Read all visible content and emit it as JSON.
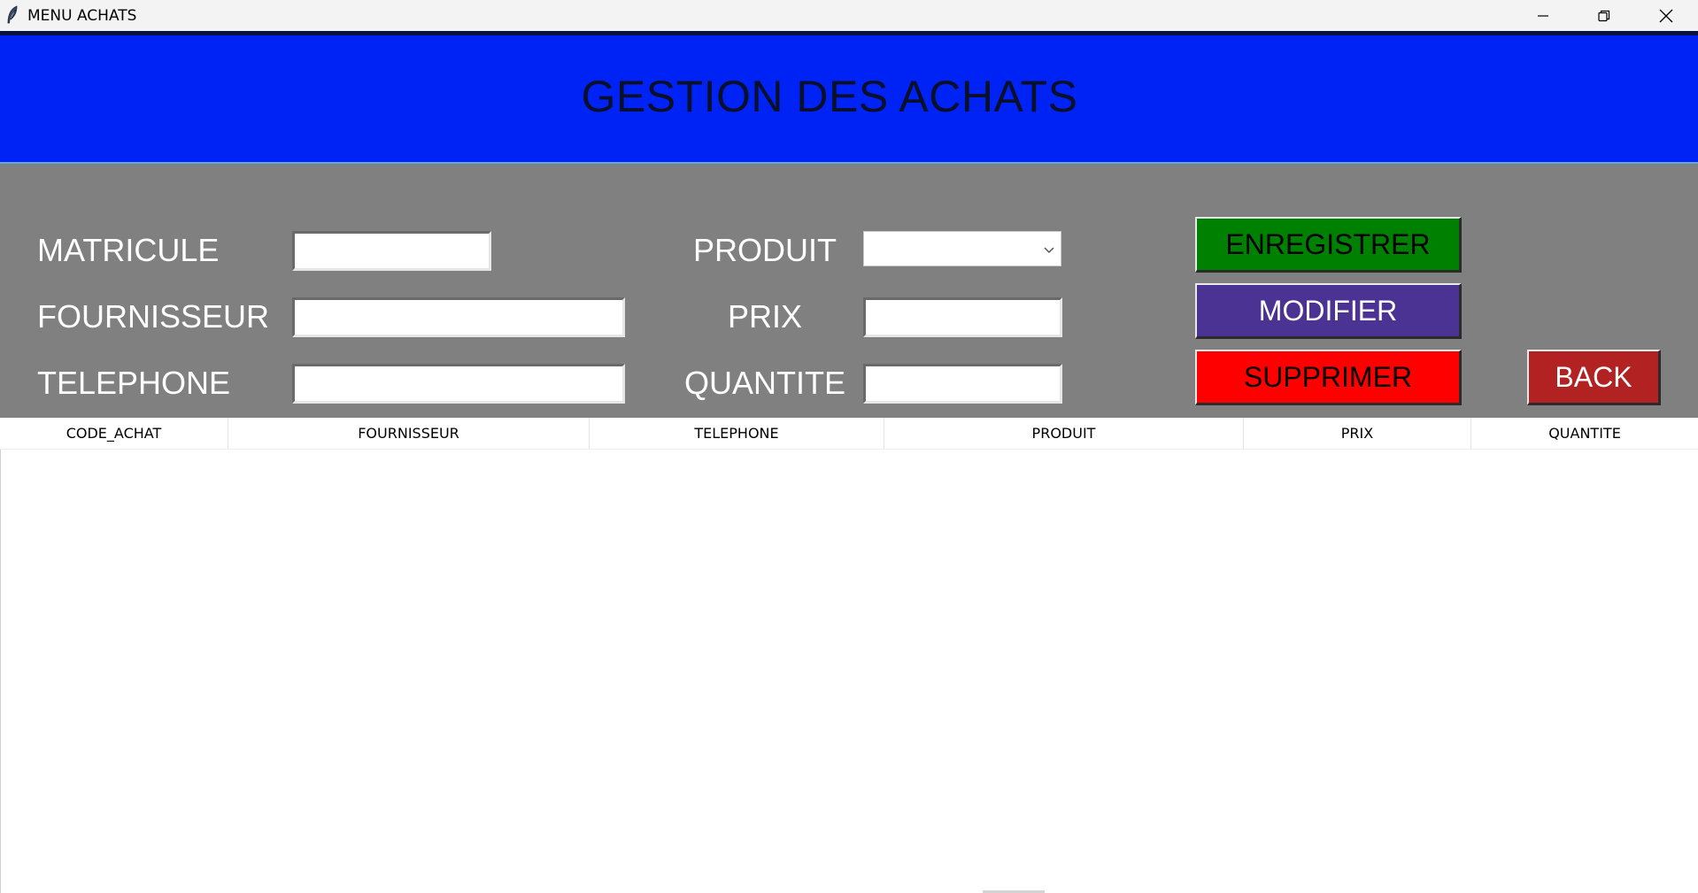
{
  "window": {
    "title": "MENU ACHATS",
    "icon": "feather-icon",
    "controls": [
      "minimize-icon",
      "restore-icon",
      "close-icon"
    ]
  },
  "header": {
    "title": "GESTION DES ACHATS",
    "background": "#0023f5"
  },
  "form": {
    "background": "#808080",
    "matricule": {
      "label": "MATRICULE",
      "value": "",
      "placeholder": ""
    },
    "fournisseur": {
      "label": "FOURNISSEUR",
      "value": "",
      "placeholder": ""
    },
    "telephone": {
      "label": "TELEPHONE",
      "value": "",
      "placeholder": ""
    },
    "produit": {
      "label": "PRODUIT",
      "selected": ""
    },
    "prix": {
      "label": "PRIX",
      "value": "",
      "placeholder": ""
    },
    "quantite": {
      "label": "QUANTITE",
      "value": "",
      "placeholder": ""
    }
  },
  "buttons": {
    "enregistrer": {
      "label": "ENREGISTRER",
      "bg": "#008000",
      "fg": "#000000"
    },
    "modifier": {
      "label": "MODIFIER",
      "bg": "#4b3394",
      "fg": "#ffffff"
    },
    "supprimer": {
      "label": "SUPPRIMER",
      "bg": "#ff0000",
      "fg": "#000000"
    },
    "back": {
      "label": "BACK",
      "bg": "#b22222",
      "fg": "#ffffff"
    }
  },
  "table": {
    "columns": [
      "CODE_ACHAT",
      "FOURNISSEUR",
      "TELEPHONE",
      "PRODUIT",
      "PRIX",
      "QUANTITE"
    ],
    "rows": []
  }
}
